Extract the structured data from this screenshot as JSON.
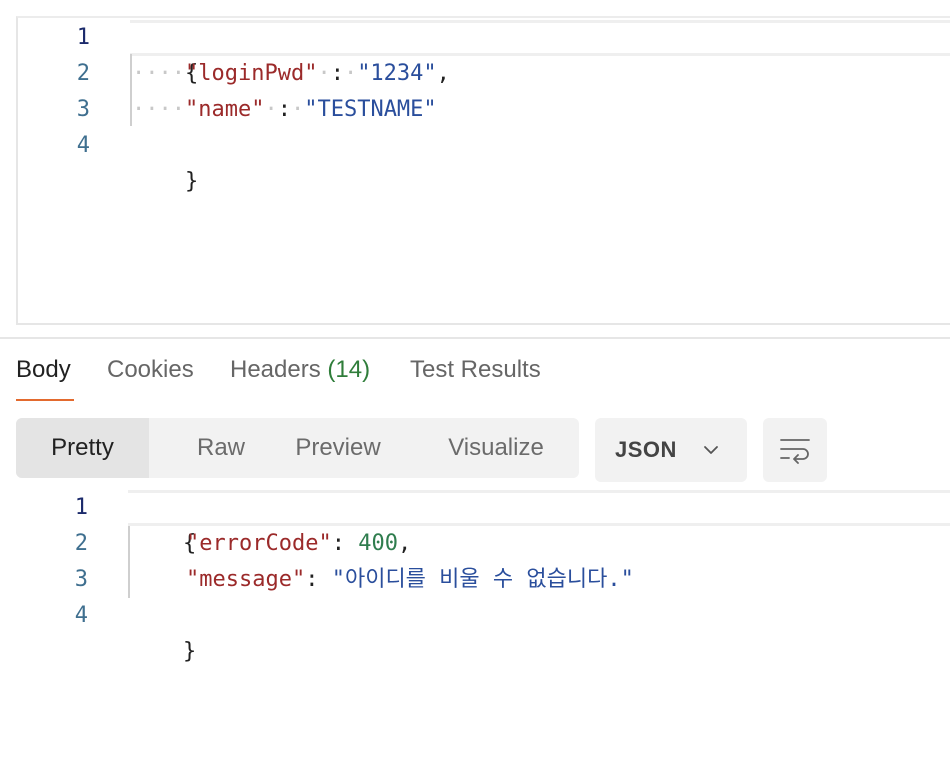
{
  "request_editor": {
    "line_numbers": [
      "1",
      "2",
      "3",
      "4"
    ],
    "lines": {
      "l1": {
        "brace": "{"
      },
      "l2": {
        "key": "\"loginPwd\"",
        "sep": ":",
        "value": "\"1234\"",
        "comma": ","
      },
      "l3": {
        "key": "\"name\"",
        "sep": ":",
        "value": "\"TESTNAME\""
      },
      "l4": {
        "brace": "}"
      }
    },
    "whitespace_dots": "····",
    "space_dot": "·"
  },
  "response_tabs": {
    "body": "Body",
    "cookies": "Cookies",
    "headers": "Headers",
    "headers_count": "(14)",
    "test_results": "Test Results"
  },
  "format_modes": {
    "pretty": "Pretty",
    "raw": "Raw",
    "preview": "Preview",
    "visualize": "Visualize"
  },
  "language_select": {
    "value": "JSON"
  },
  "response_editor": {
    "line_numbers": [
      "1",
      "2",
      "3",
      "4"
    ],
    "lines": {
      "l1": {
        "brace": "{"
      },
      "l2": {
        "key": "\"errorCode\"",
        "sep": ":",
        "value": "400",
        "comma": ","
      },
      "l3": {
        "key": "\"message\"",
        "sep": ":",
        "value": "\"아이디를 비울 수 없습니다.\""
      },
      "l4": {
        "brace": "}"
      }
    }
  },
  "colors": {
    "accent": "#e36a2e",
    "json_key": "#9b2a2a",
    "json_string": "#2a4e9c",
    "json_number": "#2f7d4e",
    "count_green": "#2f7d3a"
  },
  "icons": [
    "chevron-down-icon",
    "wrap-lines-icon"
  ]
}
